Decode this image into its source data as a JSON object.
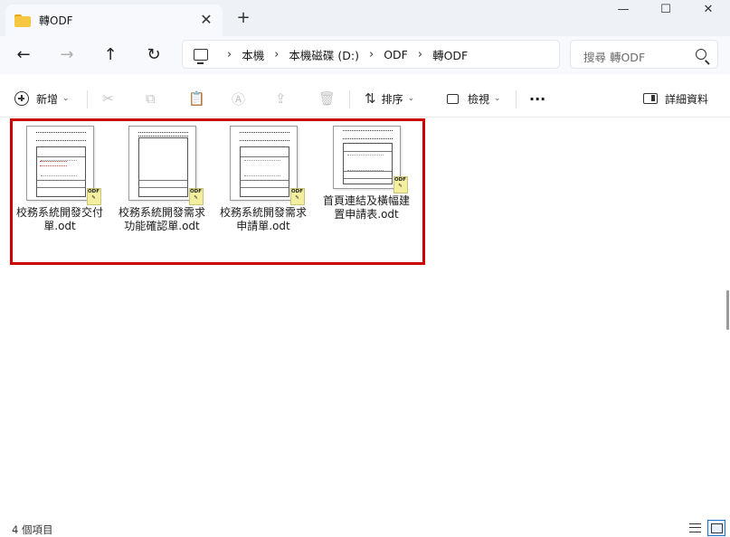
{
  "window": {
    "tab_title": "轉ODF",
    "tab_close": "✕",
    "new_tab": "+",
    "minimize": "—",
    "maximize": "☐",
    "close": "✕"
  },
  "nav": {
    "back": "←",
    "forward": "→",
    "up": "↑",
    "refresh": "↻",
    "breadcrumb_sep": "›",
    "breadcrumbs": [
      "本機",
      "本機磁碟 (D:)",
      "ODF",
      "轉ODF"
    ],
    "search_placeholder": "搜尋 轉ODF"
  },
  "commands": {
    "new_label": "新增",
    "chevron": "⌄",
    "cut_icon": "✂",
    "copy_icon": "⧉",
    "paste_icon": "📋",
    "rename_icon": "Ⓐ",
    "share_icon": "⇪",
    "delete_icon": "🗑",
    "sort_icon": "⇅",
    "sort_label": "排序",
    "view_label": "檢視",
    "more": "···",
    "details_label": "詳細資料"
  },
  "files": [
    {
      "name": "校務系統開發交付單.odt",
      "badge": "ODF"
    },
    {
      "name": "校務系統開發需求功能確認單.odt",
      "badge": "ODF"
    },
    {
      "name": "校務系統開發需求申請單.odt",
      "badge": "ODF"
    },
    {
      "name": "首頁連結及橫幅建置申請表.odt",
      "badge": "ODF"
    }
  ],
  "status": {
    "item_count": "4 個項目"
  },
  "colors": {
    "highlight_border": "#cc0000",
    "titlebar_bg": "#eef1f6",
    "folder_yellow": "#f7c744"
  }
}
